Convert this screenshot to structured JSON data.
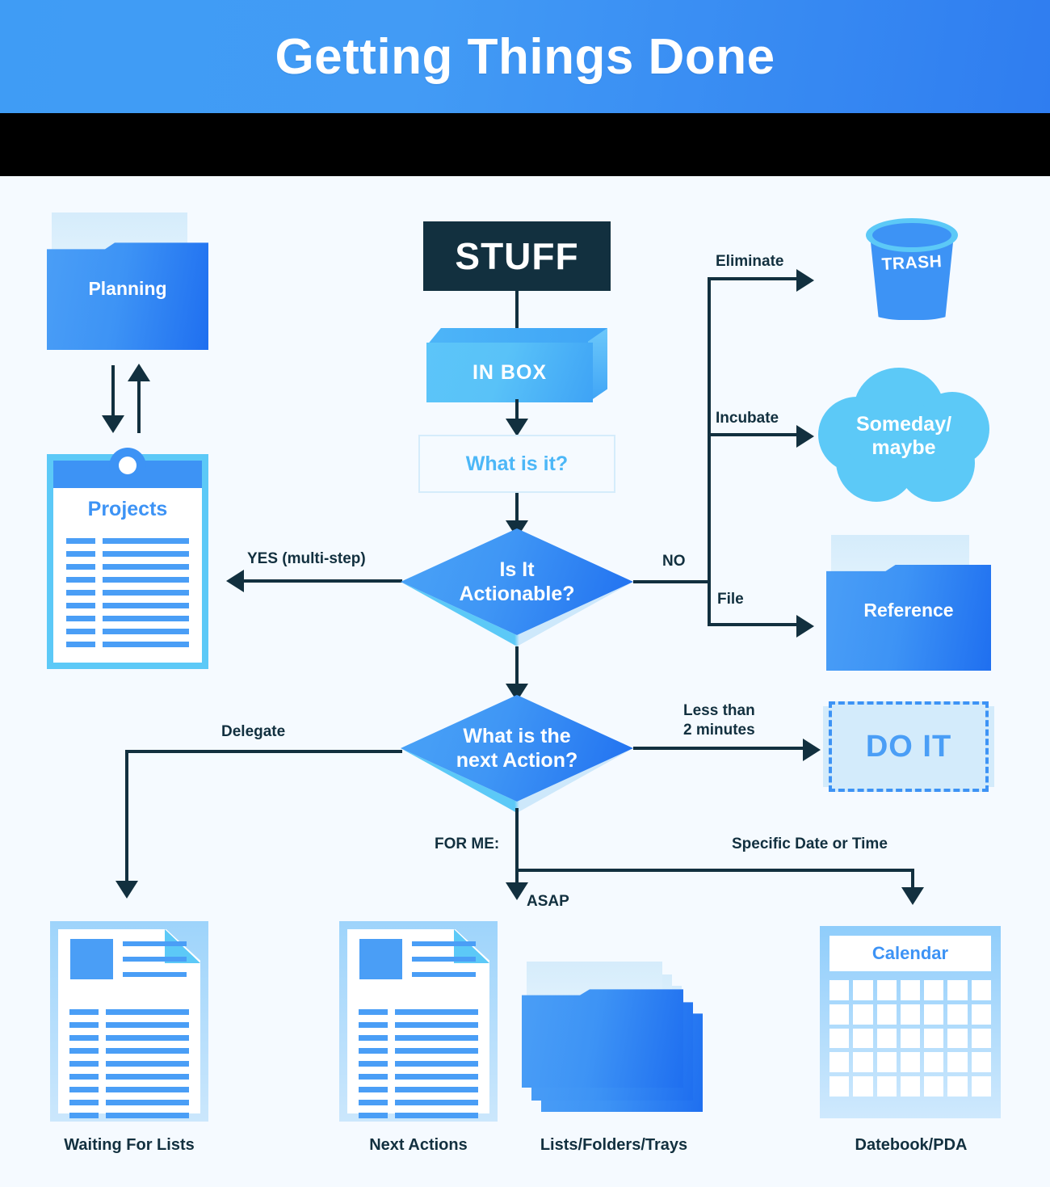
{
  "header": {
    "title": "Getting Things Done"
  },
  "nodes": {
    "planning": {
      "label": "Planning",
      "icon": "folder-icon"
    },
    "projects": {
      "label": "Projects",
      "icon": "clipboard-icon",
      "line_rows": 9
    },
    "stuff": {
      "label": "STUFF"
    },
    "inbox": {
      "label": "IN BOX"
    },
    "what_is_it": {
      "label": "What is it?"
    },
    "is_it_actionable": {
      "label": "Is It\nActionable?"
    },
    "next_action": {
      "label": "What is the\nnext Action?"
    },
    "trash": {
      "label": "TRASH",
      "icon": "trash-can-icon"
    },
    "someday": {
      "label": "Someday/\nmaybe",
      "icon": "cloud-icon"
    },
    "reference": {
      "label": "Reference",
      "icon": "folder-icon"
    },
    "do_it": {
      "label": "DO IT"
    },
    "calendar": {
      "label": "Calendar",
      "icon": "calendar-icon",
      "grid_cols": 7,
      "grid_rows": 5
    }
  },
  "connectors": {
    "eliminate": "Eliminate",
    "incubate": "Incubate",
    "file": "File",
    "no": "NO",
    "yes_multi_step": "YES (multi-step)",
    "delegate": "Delegate",
    "less_than_2_minutes": "Less than\n2 minutes",
    "for_me": "FOR ME:",
    "asap": "ASAP",
    "specific_date_or_time": "Specific Date or Time"
  },
  "bottom_labels": {
    "waiting_for_lists": "Waiting For Lists",
    "next_actions": "Next Actions",
    "lists_folders_trays": "Lists/Folders/Trays",
    "datebook_pda": "Datebook/PDA"
  },
  "colors": {
    "background": "#f5faff",
    "header_gradient_start": "#3f9cf5",
    "header_gradient_end": "#2f7df0",
    "dark_navy": "#12303f",
    "primary_blue": "#3d93f5",
    "light_blue": "#5cc9f7",
    "pale_blue": "#d3ebfb",
    "white": "#ffffff"
  }
}
